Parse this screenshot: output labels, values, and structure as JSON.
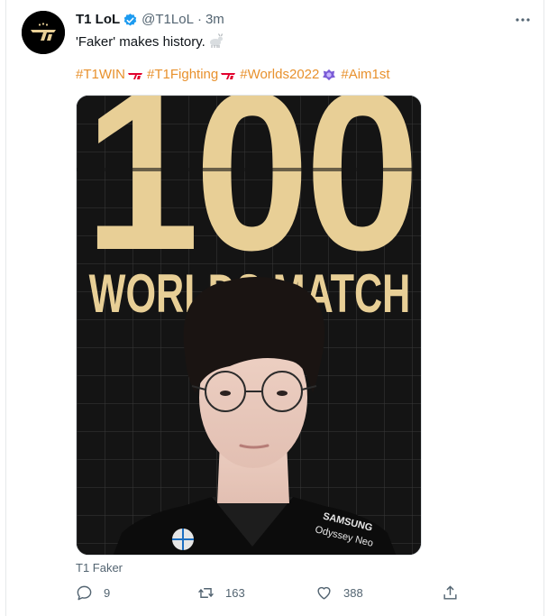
{
  "tweet": {
    "author_name": "T1 LoL",
    "author_handle": "@T1LoL",
    "separator": "·",
    "time": "3m",
    "text": "'Faker' makes history.",
    "hashtags": [
      "#T1WIN",
      "#T1Fighting",
      "#Worlds2022",
      "#Aim1st"
    ],
    "media": {
      "big_number": "100",
      "subtitle": "WORLDS MATCH",
      "jersey_sponsor_1": "SAMSUNG",
      "jersey_sponsor_2": "Odyssey Neo",
      "caption": "T1 Faker"
    },
    "actions": {
      "replies": "9",
      "retweets": "163",
      "likes": "388"
    }
  },
  "colors": {
    "hashtag": "#e8912d",
    "verified": "#1d9bf0",
    "gold": "#e8cf96",
    "muted": "#536471"
  },
  "icons": [
    "t1-logo-icon",
    "verified-badge-icon",
    "more-icon",
    "goat-emoji-icon",
    "t1-emoji-icon",
    "worlds-emoji-icon",
    "reply-icon",
    "retweet-icon",
    "like-icon",
    "share-icon"
  ]
}
